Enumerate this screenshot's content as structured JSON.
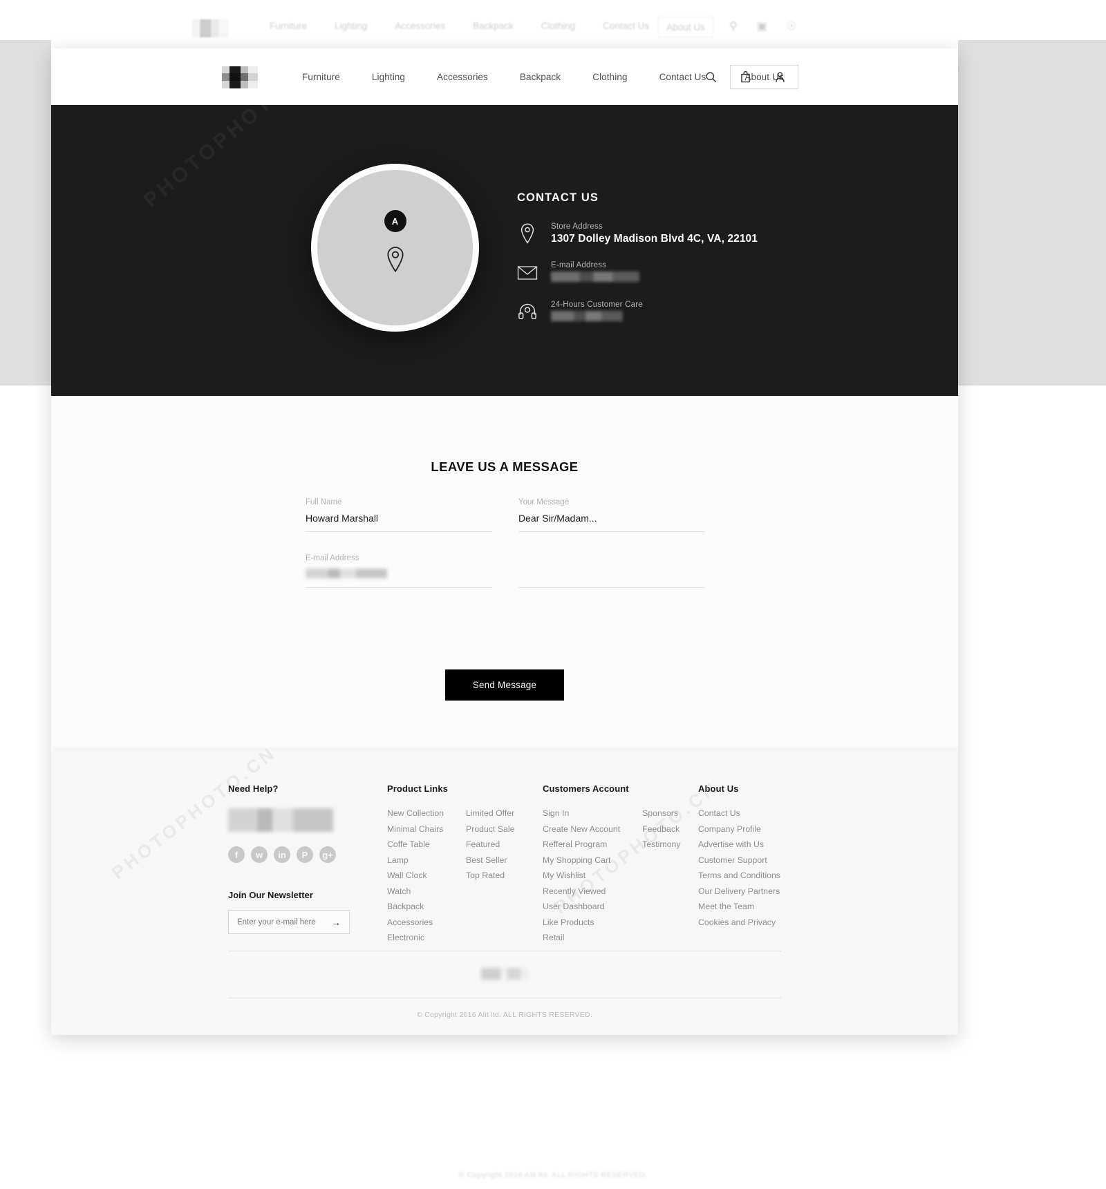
{
  "header": {
    "logo_name": "alit-logo",
    "nav": [
      {
        "label": "Furniture",
        "active": false
      },
      {
        "label": "Lighting",
        "active": false
      },
      {
        "label": "Accessories",
        "active": false
      },
      {
        "label": "Backpack",
        "active": false
      },
      {
        "label": "Clothing",
        "active": false
      },
      {
        "label": "Contact Us",
        "active": false
      },
      {
        "label": "About Us",
        "active": true
      }
    ],
    "icons": [
      "search-icon",
      "bag-icon",
      "user-icon"
    ]
  },
  "hero": {
    "map_badge": "A",
    "contact_title": "CONTACT US",
    "items": [
      {
        "icon": "location-pin-icon",
        "label": "Store Address",
        "value": "1307 Dolley Madison Blvd 4C, VA, 22101",
        "redacted": false,
        "redact_width": 0
      },
      {
        "icon": "envelope-icon",
        "label": "E-mail Address",
        "value": "",
        "redacted": true,
        "redact_width": 128
      },
      {
        "icon": "headset-icon",
        "label": "24-Hours Customer Care",
        "value": "",
        "redacted": true,
        "redact_width": 104
      }
    ]
  },
  "form": {
    "title": "LEAVE US A MESSAGE",
    "fields": [
      {
        "name": "full-name",
        "label": "Full Name",
        "value": "Howard Marshall",
        "redacted": false,
        "redact_width": 0
      },
      {
        "name": "your-message",
        "label": "Your Message",
        "value": "Dear Sir/Madam...",
        "redacted": false,
        "redact_width": 0
      },
      {
        "name": "email-address",
        "label": "E-mail Address",
        "value": "",
        "redacted": true,
        "redact_width": 118
      },
      {
        "name": "message-line-2",
        "label": "",
        "value": "",
        "redacted": false,
        "redact_width": 0
      }
    ],
    "submit_label": "Send Message"
  },
  "footer": {
    "help": {
      "heading": "Need Help?",
      "phone_redacted": true,
      "socials": [
        "facebook-icon",
        "twitter-icon",
        "linkedin-icon",
        "pinterest-icon",
        "googleplus-icon"
      ],
      "newsletter_heading": "Join Our Newsletter",
      "newsletter_placeholder": "Enter your e-mail here",
      "newsletter_value": "",
      "newsletter_arrow": "→"
    },
    "product_links": {
      "heading": "Product Links",
      "col1": [
        "New Collection",
        "Minimal Chairs",
        "Coffe Table",
        "Lamp",
        "Wall Clock",
        "Watch",
        "Backpack",
        "Accessories",
        "Electronic"
      ],
      "col2": [
        "Limited Offer",
        "Product Sale",
        "Featured",
        "Best Seller",
        "Top Rated"
      ]
    },
    "customers_account": {
      "heading": "Customers Account",
      "col1": [
        "Sign In",
        "Create New Account",
        "Refferal Program",
        "My Shopping Cart",
        "My Wishlist",
        "Recently Viewed",
        "User Dashboard",
        "Like Products",
        "Retail"
      ],
      "col2": [
        "Sponsors",
        "Feedback",
        "Testimony"
      ]
    },
    "about": {
      "heading": "About Us",
      "links": [
        "Contact Us",
        "Company Profile",
        "Advertise with Us",
        "Customer Support",
        "Terms and Conditions",
        "Our Delivery Partners",
        "Meet the Team",
        "Cookies and Privacy"
      ]
    },
    "copyright": "© Copyright 2016 Alit ltd. ALL RIGHTS RESERVED."
  },
  "colors": {
    "hero_bg": "#1c1c1c",
    "page_bg": "#ffffff",
    "footer_bg": "#f7f7f7",
    "accent": "#000000",
    "muted_text": "#8e8e8e"
  },
  "watermarks": {
    "text": "PHOTOPHOTO.CN"
  }
}
